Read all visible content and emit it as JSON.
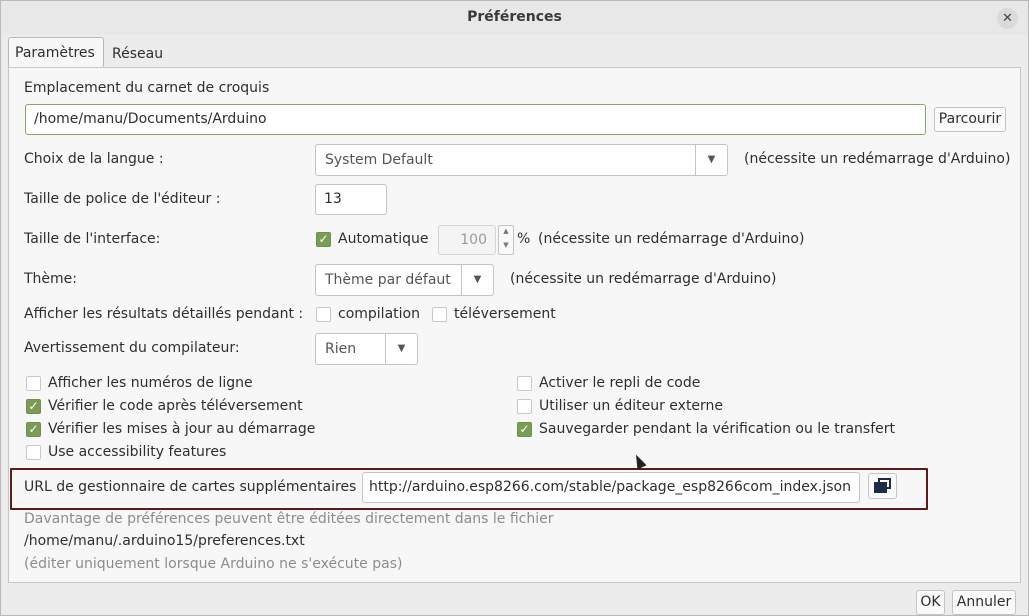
{
  "window": {
    "title": "Préférences"
  },
  "tabs": [
    {
      "label": "Paramètres",
      "active": true
    },
    {
      "label": "Réseau",
      "active": false
    }
  ],
  "sketchbook": {
    "label": "Emplacement du carnet de croquis",
    "value": "/home/manu/Documents/Arduino",
    "browse_label": "Parcourir"
  },
  "language": {
    "label": "Choix de la langue :",
    "selected": "System Default",
    "note": "(nécessite un redémarrage d'Arduino)"
  },
  "font_size": {
    "label": "Taille de police de l'éditeur :",
    "value": "13"
  },
  "interface_scale": {
    "label": "Taille de l'interface:",
    "auto_label": "Automatique",
    "auto_checked": true,
    "value": "100",
    "unit": "%",
    "note": "(nécessite un redémarrage d'Arduino)"
  },
  "theme": {
    "label": "Thème:",
    "selected": "Thème par défaut",
    "note": "(nécessite un redémarrage d'Arduino)"
  },
  "verbose": {
    "label": "Afficher les résultats détaillés pendant :",
    "compile_label": "compilation",
    "compile_checked": false,
    "upload_label": "téléversement",
    "upload_checked": false
  },
  "warnings": {
    "label": "Avertissement du compilateur:",
    "selected": "Rien"
  },
  "options_left": [
    {
      "label": "Afficher les numéros de ligne",
      "checked": false
    },
    {
      "label": "Vérifier le code après téléversement",
      "checked": true
    },
    {
      "label": "Vérifier les mises à jour au démarrage",
      "checked": true
    },
    {
      "label": "Use accessibility features",
      "checked": false
    }
  ],
  "options_right": [
    {
      "label": "Activer le repli de code",
      "checked": false
    },
    {
      "label": "Utiliser un éditeur externe",
      "checked": false
    },
    {
      "label": "Sauvegarder pendant la vérification ou le transfert",
      "checked": true
    }
  ],
  "boards_url": {
    "label": "URL de gestionnaire de cartes supplémentaires",
    "value": "http://arduino.esp8266.com/stable/package_esp8266com_index.json"
  },
  "footer": {
    "info_line1": "Davantage de préférences peuvent être éditées directement dans le fichier",
    "path": "/home/manu/.arduino15/preferences.txt",
    "info_line2": "(éditer uniquement lorsque Arduino ne s'exécute pas)"
  },
  "buttons": {
    "ok": "OK",
    "cancel": "Annuler"
  },
  "colors": {
    "check_accent": "#7a9c54",
    "highlight_border": "#5b1a1d",
    "focus_border": "#87a964"
  }
}
